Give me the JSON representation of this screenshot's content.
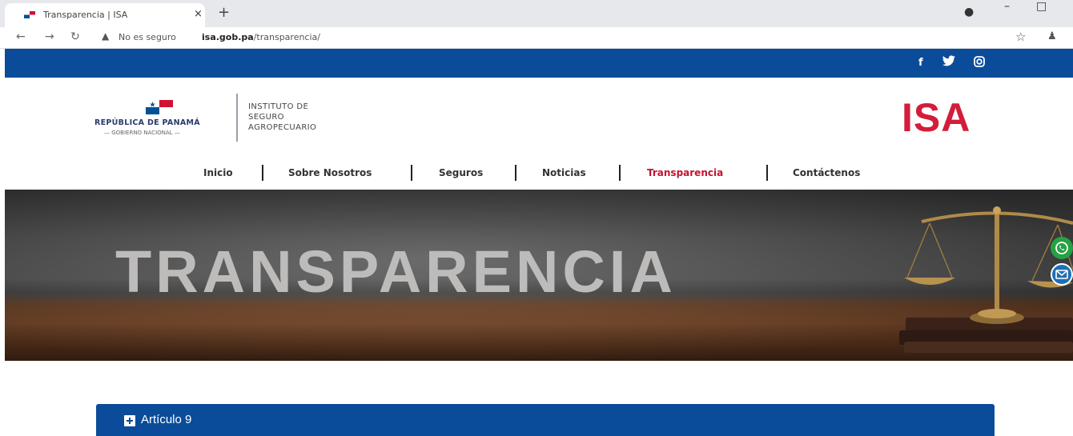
{
  "browser": {
    "tab_title": "Transparencia | ISA",
    "tab_close": "×",
    "new_tab": "+",
    "security_label": "No es seguro",
    "url_domain": "isa.gob.pa",
    "url_path": "/transparencia/",
    "icons": [
      "back-icon",
      "forward-icon",
      "reload-icon",
      "warning-icon",
      "star-icon",
      "profile-icon"
    ]
  },
  "topbar": {
    "social": [
      "f",
      "twitter",
      "instagram"
    ]
  },
  "header": {
    "gov_title": "REPÚBLICA DE PANAMÁ",
    "gov_subtitle": "— GOBIERNO NACIONAL —",
    "institute_name": "INSTITUTO DE\nSEGURO\nAGROPECUARIO",
    "logo_text": "ISA"
  },
  "nav": {
    "items": [
      {
        "label": "Inicio",
        "active": false
      },
      {
        "label": "Sobre Nosotros",
        "active": false
      },
      {
        "label": "Seguros",
        "active": false
      },
      {
        "label": "Noticias",
        "active": false
      },
      {
        "label": "Transparencia",
        "active": true
      },
      {
        "label": "Contáctenos",
        "active": false
      }
    ]
  },
  "hero": {
    "title": "TRANSPARENCIA"
  },
  "content": {
    "accordion_label": "Artículo 9"
  },
  "colors": {
    "brand_blue": "#0a4c99",
    "brand_red": "#d31d3a",
    "nav_active": "#c4122f"
  }
}
